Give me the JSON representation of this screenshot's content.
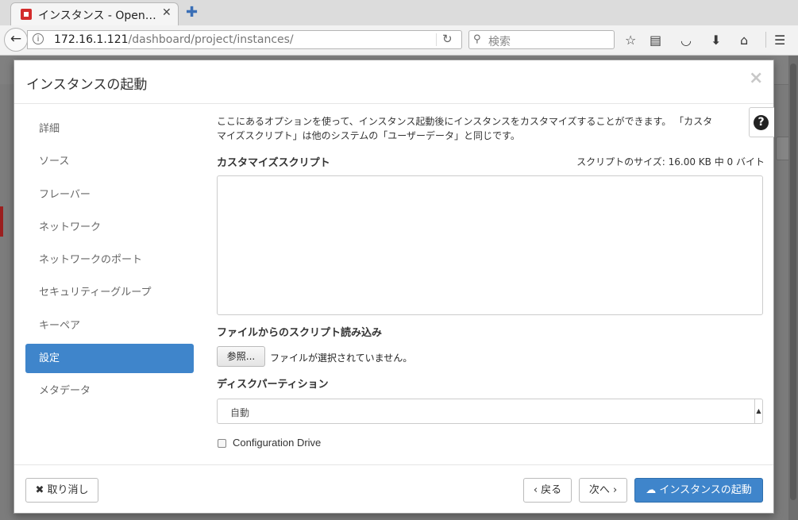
{
  "browser": {
    "tab_title": "インスタンス - Open…",
    "tab_close": "✕",
    "new_tab": "✚",
    "url_host": "172.16.1.121",
    "url_path": "/dashboard/project/instances/",
    "search_placeholder": "検索"
  },
  "modal": {
    "title": "インスタンスの起動",
    "close": "×",
    "nav": [
      "詳細",
      "ソース",
      "フレーバー",
      "ネットワーク",
      "ネットワークのポート",
      "セキュリティーグループ",
      "キーペア",
      "設定",
      "メタデータ"
    ],
    "active_nav": "設定",
    "description_line1": "ここにあるオプションを使って、インスタンス起動後にインスタンスをカスタマイズすることができます。 「カスタ",
    "description_line2": "マイズスクリプト」は他のシステムの「ユーザーデータ」と同じです。",
    "script_label": "カスタマイズスクリプト",
    "script_size": "スクリプトのサイズ: 16.00 KB 中 0 バイト",
    "script_value": "",
    "file_label": "ファイルからのスクリプト読み込み",
    "browse_button": "参照...",
    "file_status": "ファイルが選択されていません。",
    "disk_label": "ディスクパーティション",
    "disk_value": "自動",
    "config_drive_label": "Configuration Drive",
    "config_drive_checked": false,
    "cancel_button": "✖ 取り消し",
    "back_button": "‹ 戻る",
    "next_button": "次へ ›",
    "launch_button": "インスタンスの起動"
  },
  "colors": {
    "accent": "#3f85cb",
    "overlay": "#7b7b7b"
  }
}
